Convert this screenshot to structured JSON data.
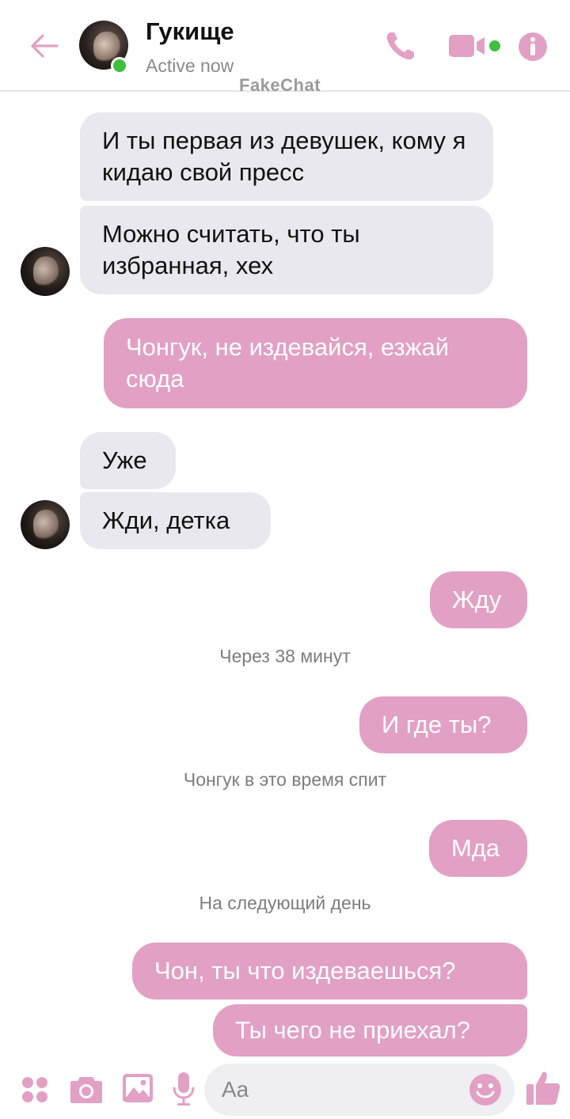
{
  "header": {
    "back_icon": "arrow-left-icon",
    "name": "Гукище",
    "status": "Active now",
    "watermark": "FakeChat",
    "icons": [
      "phone-icon",
      "video-camera-icon",
      "info-icon"
    ]
  },
  "colors": {
    "accent": "#e2a0c4",
    "incoming_bubble": "#e9e8ee",
    "online": "#3fbf3f"
  },
  "messages": [
    {
      "side": "in",
      "text": "И ты первая из девушек, кому я кидаю свой пресс"
    },
    {
      "side": "in",
      "text": "Можно считать, что ты избранная, хех"
    },
    {
      "side": "out",
      "text": "Чонгук, не издевайся, езжай сюда"
    },
    {
      "side": "in",
      "text": "Уже"
    },
    {
      "side": "in",
      "text": "Жди, детка"
    },
    {
      "side": "out",
      "text": "Жду"
    },
    {
      "side": "system",
      "text": "Через 38 минут"
    },
    {
      "side": "out",
      "text": "И где ты?"
    },
    {
      "side": "system",
      "text": "Чонгук в это время спит"
    },
    {
      "side": "out",
      "text": "Мда"
    },
    {
      "side": "system",
      "text": "На следующий день"
    },
    {
      "side": "out",
      "text": "Чон, ты что издеваешься?"
    },
    {
      "side": "out",
      "text": "Ты чего не приехал?"
    }
  ],
  "composer": {
    "placeholder": "Aa",
    "icons": [
      "apps-grid-icon",
      "camera-icon",
      "gallery-icon",
      "microphone-icon",
      "emoji-icon",
      "thumbs-up-icon"
    ]
  }
}
